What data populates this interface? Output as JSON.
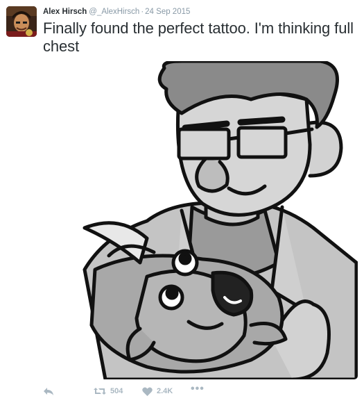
{
  "tweet": {
    "author_name": "Alex Hirsch",
    "handle": "@_AlexHirsch",
    "separator": "·",
    "date": "24 Sep 2015",
    "text": "Finally found the perfect tattoo. I'm thinking full chest"
  },
  "actions": {
    "reply_icon": "reply-icon",
    "retweet_icon": "retweet-icon",
    "retweet_count": "504",
    "like_icon": "heart-icon",
    "like_count": "2.4K",
    "more_icon": "more-icon",
    "more_label": "•••"
  },
  "colors": {
    "text": "#292f33",
    "muted": "#8899a6",
    "action": "#aab8c2"
  }
}
